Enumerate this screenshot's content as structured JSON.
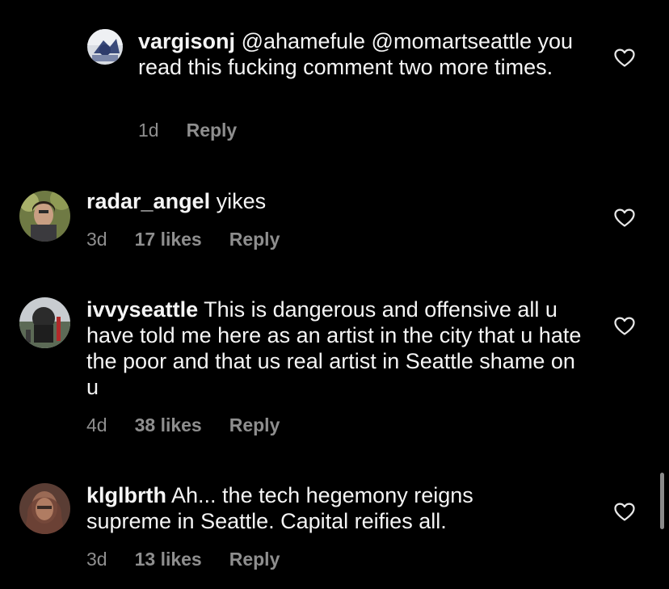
{
  "comments": [
    {
      "username": "vargisonj",
      "text": "@ahamefule @momartseattle you read this fucking comment two more times.",
      "time": "1d",
      "likes": "",
      "reply": "Reply",
      "avatar_icon": "user-avatar-photo",
      "heart_icon": "heart-outline-icon"
    },
    {
      "username": "radar_angel",
      "text": "yikes",
      "time": "3d",
      "likes": "17 likes",
      "reply": "Reply",
      "avatar_icon": "user-avatar-photo",
      "heart_icon": "heart-outline-icon"
    },
    {
      "username": "ivvyseattle",
      "text": "This is dangerous and offensive all u have told me here as an artist in the city that u hate the poor and that us real artist in Seattle shame on u",
      "time": "4d",
      "likes": "38 likes",
      "reply": "Reply",
      "avatar_icon": "user-avatar-photo",
      "heart_icon": "heart-outline-icon"
    },
    {
      "username": "klglbrth",
      "text": "Ah... the tech hegemony reigns supreme in Seattle. Capital reifies all.",
      "time": "3d",
      "likes": "13 likes",
      "reply": "Reply",
      "avatar_icon": "user-avatar-photo",
      "heart_icon": "heart-outline-icon"
    }
  ],
  "colors": {
    "background": "#000000",
    "text": "#f5f5f5",
    "secondary": "#8e8e8e"
  }
}
